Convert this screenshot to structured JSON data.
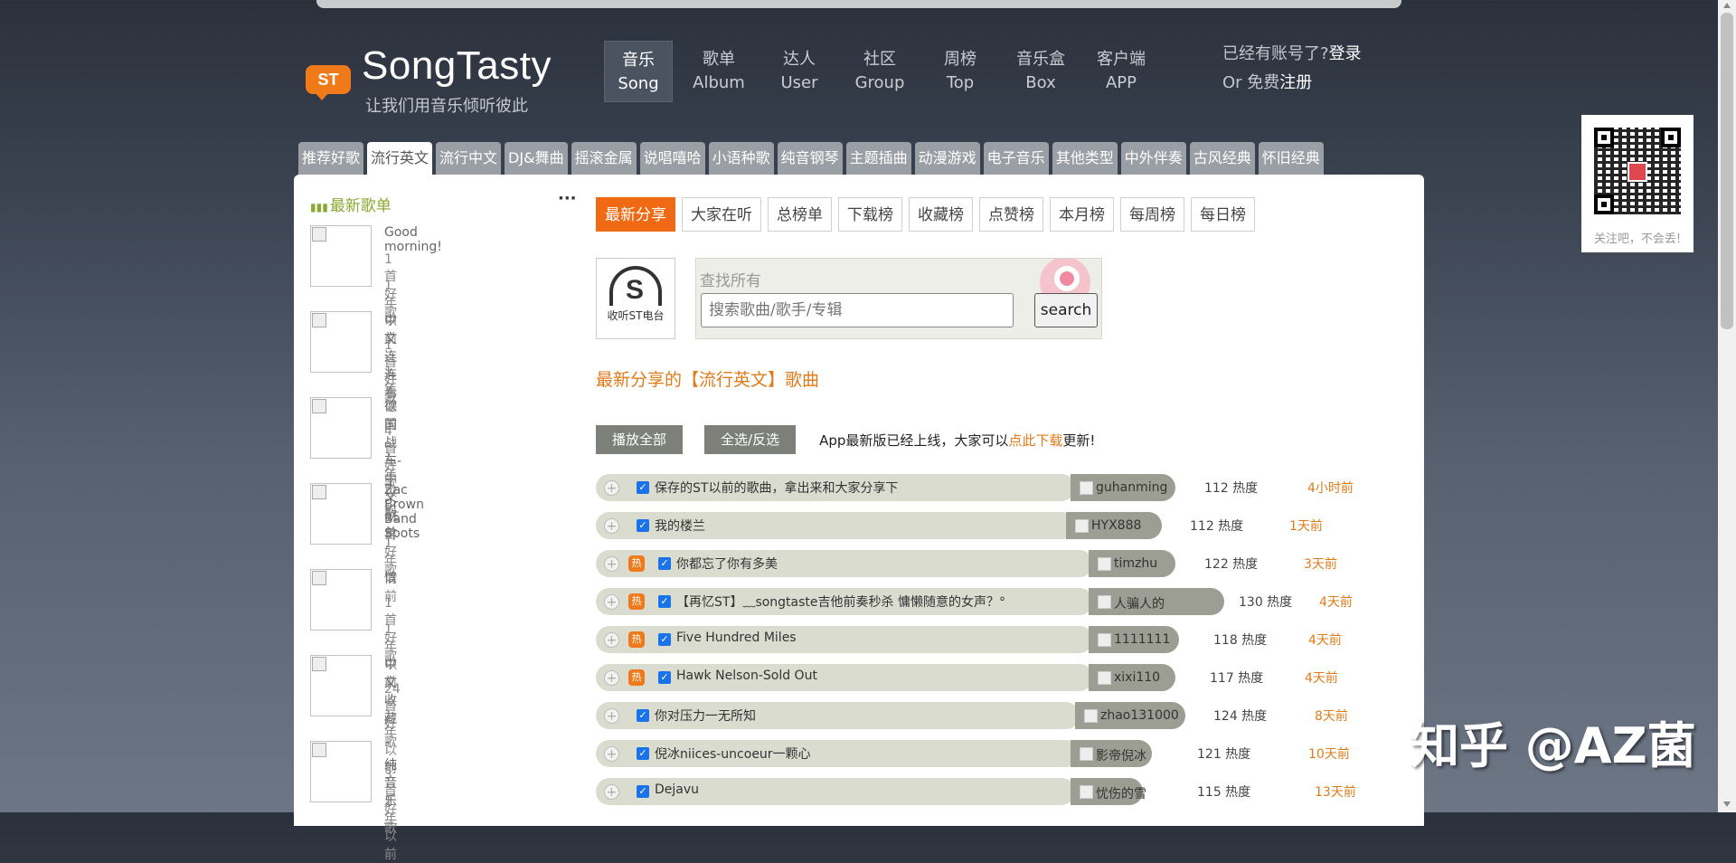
{
  "brand": {
    "badge": "ST",
    "name": "SongTasty",
    "slogan": "让我们用音乐倾听彼此"
  },
  "nav": [
    {
      "cn": "音乐",
      "en": "Song",
      "active": true
    },
    {
      "cn": "歌单",
      "en": "Album"
    },
    {
      "cn": "达人",
      "en": "User"
    },
    {
      "cn": "社区",
      "en": "Group"
    },
    {
      "cn": "周榜",
      "en": "Top"
    },
    {
      "cn": "音乐盒",
      "en": "Box"
    },
    {
      "cn": "客户端",
      "en": "APP"
    }
  ],
  "account": {
    "prompt": "已经有账号了?",
    "login": "登录",
    "or": "Or 免费",
    "register": "注册"
  },
  "genre_tabs": [
    "推荐好歌",
    "流行英文",
    "流行中文",
    "DJ&舞曲",
    "摇滚金属",
    "说唱嘻哈",
    "小语种歌",
    "纯音钢琴",
    "主题插曲",
    "动漫游戏",
    "电子音乐",
    "其他类型",
    "中外伴奏",
    "古风经典",
    "怀旧经典"
  ],
  "genre_active": "流行英文",
  "sidebar": {
    "title": "最新歌单",
    "more": "···",
    "playlists": [
      {
        "name": "Good morning!",
        "count": "1首好歌",
        "date": "1年以前"
      },
      {
        "name": "中文连连看",
        "count": "1首好歌",
        "date": "1年以前"
      },
      {
        "name": "德国战车-中文歌单",
        "count": "4首好歌",
        "date": "1年以前"
      },
      {
        "name": "Zac Brown Band Spots",
        "count": "15首好歌",
        "date": "1年以前"
      },
      {
        "name": "情",
        "count": "1首好歌",
        "date": "1年以前"
      },
      {
        "name": "中文收藏",
        "count": "24首好歌",
        "date": "1年以前"
      },
      {
        "name": "ˆ 纯音乐﹏",
        "count": "3首好歌",
        "date": "1年以前"
      }
    ]
  },
  "rank_tabs": [
    "最新分享",
    "大家在听",
    "总榜单",
    "下载榜",
    "收藏榜",
    "点赞榜",
    "本月榜",
    "每周榜",
    "每日榜"
  ],
  "radio": {
    "label": "收听ST电台"
  },
  "search": {
    "label": "查找所有",
    "placeholder": "搜索歌曲/歌手/专辑",
    "button": "search"
  },
  "section_title": "最新分享的【流行英文】歌曲",
  "controls": {
    "play_all": "播放全部",
    "select_all": "全选/反选",
    "notice_prefix": "App最新版已经上线，大家可以",
    "notice_link": "点此下载",
    "notice_suffix": "更新!"
  },
  "songs": [
    {
      "title": "保存的ST以前的歌曲，拿出来和大家分享下",
      "user": "guhanming",
      "heat": "112 热度",
      "time": "4小时前",
      "hot": false
    },
    {
      "title": "我的楼兰",
      "user": "HYX888",
      "heat": "112 热度",
      "time": "1天前",
      "hot": false
    },
    {
      "title": "你都忘了你有多美",
      "user": "timzhu",
      "heat": "122 热度",
      "time": "3天前",
      "hot": true
    },
    {
      "title": "【再忆ST】﹏songtaste吉他前奏秒杀 慵懒随意的女声？°",
      "user": "人骗人的",
      "heat": "130 热度",
      "time": "4天前",
      "hot": true
    },
    {
      "title": "Five Hundred Miles",
      "user": "1111111",
      "heat": "118 热度",
      "time": "4天前",
      "hot": true
    },
    {
      "title": "Hawk Nelson-Sold Out",
      "user": "xixi110",
      "heat": "117 热度",
      "time": "4天前",
      "hot": true
    },
    {
      "title": "你对压力一无所知",
      "user": "zhao131000",
      "heat": "124 热度",
      "time": "8天前",
      "hot": false
    },
    {
      "title": "倪冰niices-uncoeur一颗心",
      "user": "影帝倪冰",
      "heat": "121 热度",
      "time": "10天前",
      "hot": false
    },
    {
      "title": "Dejavu",
      "user": "忧伤的雪",
      "heat": "115 热度",
      "time": "13天前",
      "hot": false
    }
  ],
  "qr": {
    "caption": "关注吧，不会丢!"
  },
  "watermark": "知乎 @AZ菌",
  "icons": {
    "play": "plus-circle-icon",
    "hot": "hot-badge-icon",
    "check": "checkbox-checked-icon"
  },
  "colors": {
    "accent": "#f06a13",
    "green": "#8aa832",
    "bar": "#dadccf"
  }
}
